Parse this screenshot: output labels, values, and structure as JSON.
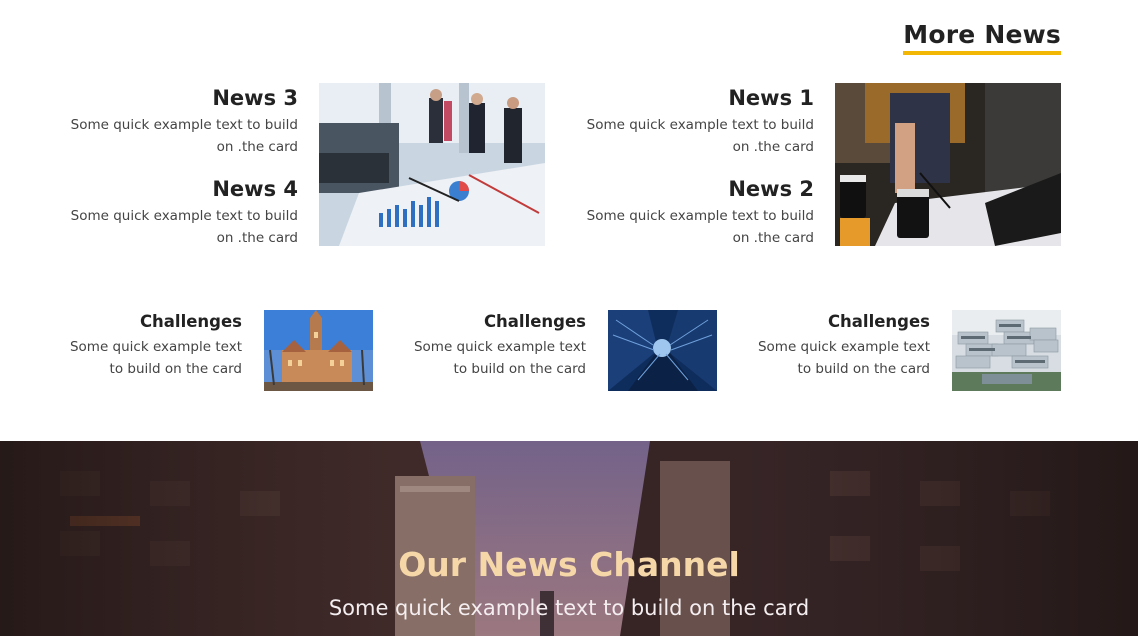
{
  "section": {
    "title": "More News"
  },
  "news": [
    {
      "title": "News 3",
      "text": "Some quick example text to build on .the card",
      "image": "business-meeting-charts-image"
    },
    {
      "title": "News 4",
      "text": "Some quick example text to build on .the card"
    },
    {
      "title": "News 1",
      "text": "Some quick example text to build on .the card",
      "image": "business-pointing-laptop-image"
    },
    {
      "title": "News 2",
      "text": "Some quick example text to build on .the card"
    }
  ],
  "challenges": [
    {
      "title": "Challenges",
      "text": "Some quick example text to build on the card",
      "image": "gothic-building-image"
    },
    {
      "title": "Challenges",
      "text": "Some quick example text to build on the card",
      "image": "skyscrapers-upward-image"
    },
    {
      "title": "Challenges",
      "text": "Some quick example text to build on the card",
      "image": "modern-stacked-building-image"
    }
  ],
  "banner": {
    "title": "Our News Channel",
    "subtitle": "Some quick example text to build on the card",
    "image": "city-street-background-image"
  },
  "colors": {
    "accent_underline": "#f2b705",
    "banner_title": "#f5d7a8",
    "banner_subtitle": "#f4eef0",
    "heading": "#222222",
    "body_text": "#444444"
  }
}
